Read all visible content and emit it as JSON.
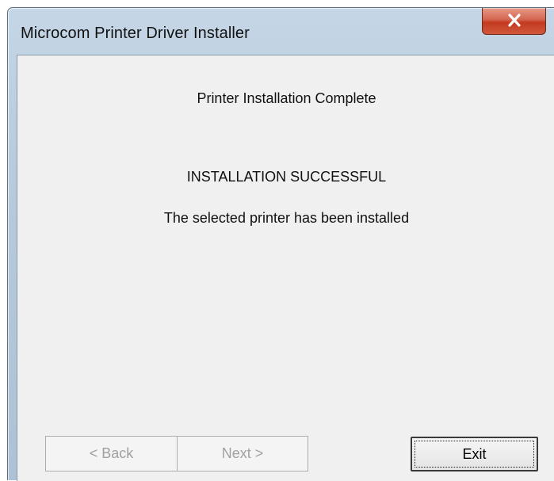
{
  "window": {
    "title": "Microcom Printer Driver Installer",
    "close_icon": "close-icon"
  },
  "content": {
    "heading": "Printer Installation Complete",
    "status": "INSTALLATION SUCCESSFUL",
    "message": "The selected printer has been installed"
  },
  "buttons": {
    "back_label": "< Back",
    "next_label": "Next >",
    "exit_label": "Exit"
  },
  "colors": {
    "title_bar": "#b8cadb",
    "client_bg": "#f0f0f0",
    "close_button": "#c33a1f"
  }
}
